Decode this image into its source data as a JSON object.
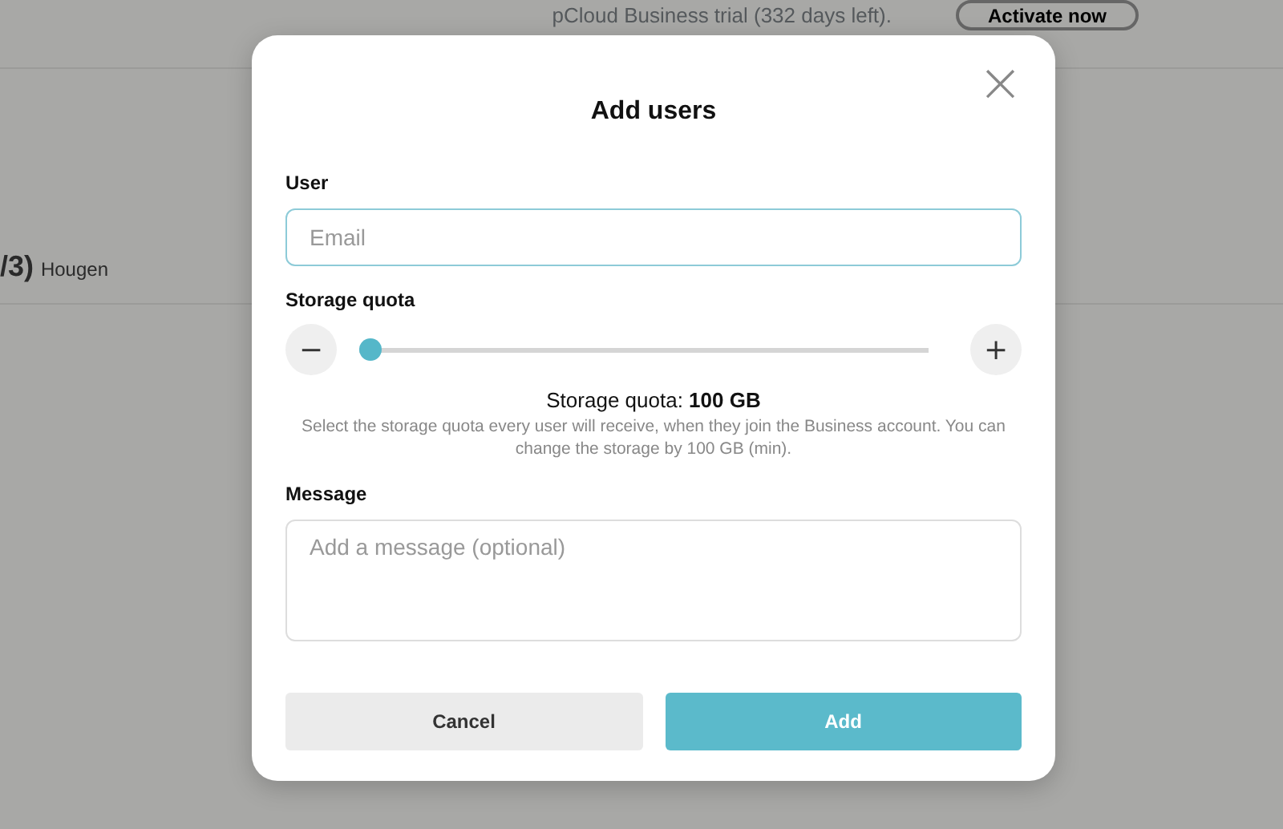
{
  "background": {
    "trial_notice": "pCloud Business trial (332 days left).",
    "activate_button": "Activate now",
    "heading_fragment": "/3)",
    "row_fragment": "Hougen"
  },
  "dialog": {
    "title": "Add users",
    "close_icon": "×",
    "user": {
      "label": "User",
      "placeholder": "Email"
    },
    "storage": {
      "label": "Storage quota",
      "minus": "−",
      "plus": "+",
      "level": 0,
      "summary": "Storage quota: **100 GB**",
      "help": "Select the storage quota every user will receive, when they join the Business account. You can change the storage by 100 GB (min)."
    },
    "message": {
      "label": "Message",
      "placeholder": "Add a message (optional)"
    },
    "buttons": [
      {
        "label": "Cancel",
        "kind": "secondary"
      },
      {
        "label": "Add",
        "kind": "primary"
      }
    ]
  }
}
